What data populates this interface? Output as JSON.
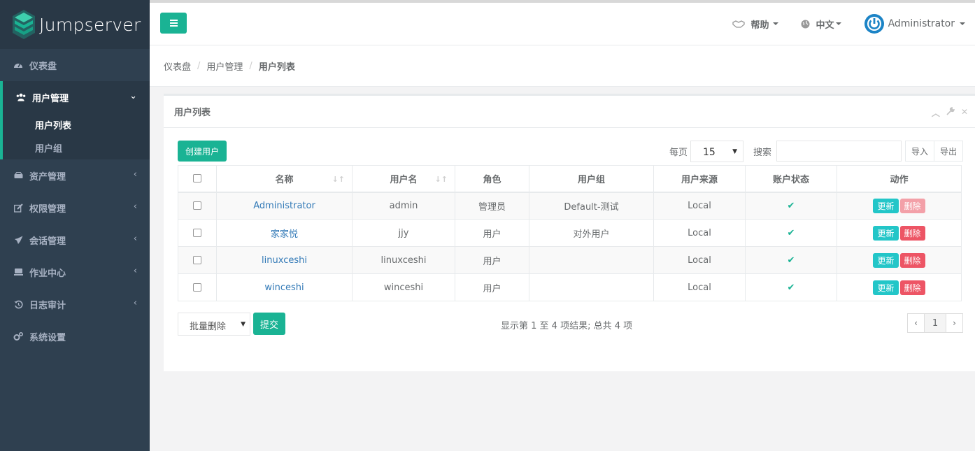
{
  "app": {
    "name": "Jumpserver"
  },
  "sidebar": {
    "items": [
      {
        "label": "仪表盘",
        "icon": "dashboard-icon"
      },
      {
        "label": "用户管理",
        "icon": "users-icon",
        "children": [
          "用户列表",
          "用户组"
        ]
      },
      {
        "label": "资产管理",
        "icon": "hdd-icon"
      },
      {
        "label": "权限管理",
        "icon": "edit-icon"
      },
      {
        "label": "会话管理",
        "icon": "rocket-icon"
      },
      {
        "label": "作业中心",
        "icon": "keyboard-icon"
      },
      {
        "label": "日志审计",
        "icon": "history-icon"
      },
      {
        "label": "系统设置",
        "icon": "cogs-icon"
      }
    ]
  },
  "topbar": {
    "help": "帮助",
    "language": "中文",
    "user": "Administrator"
  },
  "breadcrumb": [
    "仪表盘",
    "用户管理",
    "用户列表"
  ],
  "panel": {
    "title": "用户列表",
    "create_button": "创建用户",
    "per_page_label": "每页",
    "per_page_value": "15",
    "search_label": "搜索",
    "search_value": "",
    "import_label": "导入",
    "export_label": "导出"
  },
  "table": {
    "columns": [
      "名称",
      "用户名",
      "角色",
      "用户组",
      "用户来源",
      "账户状态",
      "动作"
    ],
    "rows": [
      {
        "name": "Administrator",
        "username": "admin",
        "role": "管理员",
        "group": "Default-测试",
        "source": "Local",
        "active": true
      },
      {
        "name": "家家悦",
        "username": "jjy",
        "role": "用户",
        "group": "对外用户",
        "source": "Local",
        "active": true
      },
      {
        "name": "linuxceshi",
        "username": "linuxceshi",
        "role": "用户",
        "group": "",
        "source": "Local",
        "active": true
      },
      {
        "name": "winceshi",
        "username": "winceshi",
        "role": "用户",
        "group": "",
        "source": "Local",
        "active": true
      }
    ],
    "update_label": "更新",
    "delete_label": "删除"
  },
  "footer": {
    "bulk_action": "批量删除",
    "submit_label": "提交",
    "info": "显示第 1 至 4 项结果; 总共 4 项",
    "page_prev": "‹",
    "page_current": "1",
    "page_next": "›"
  },
  "colors": {
    "accent": "#1ab394",
    "sidebar": "#2f4050",
    "update": "#23c6c8",
    "delete": "#ed5565",
    "link": "#337ab7"
  }
}
